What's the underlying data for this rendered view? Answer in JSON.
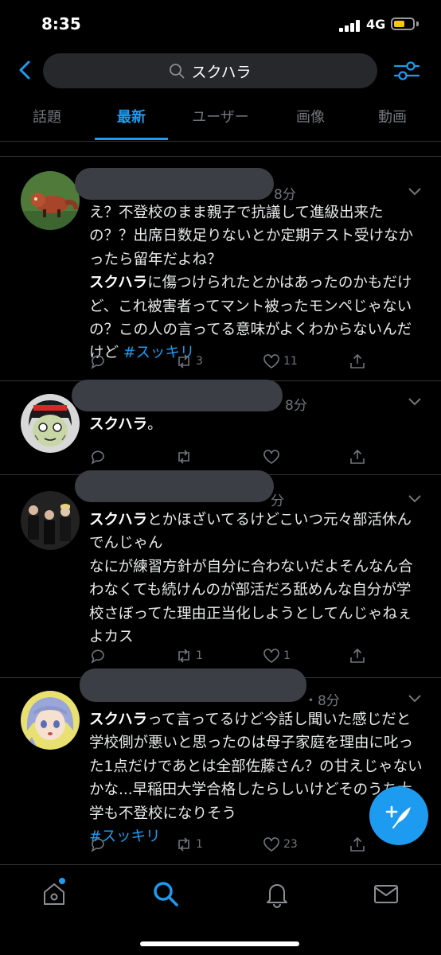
{
  "status_bar": {
    "time": "8:35",
    "network": "4G"
  },
  "search": {
    "query": "スクハラ"
  },
  "tabs": [
    {
      "label": "話題"
    },
    {
      "label": "最新"
    },
    {
      "label": "ユーザー"
    },
    {
      "label": "画像"
    },
    {
      "label": "動画"
    }
  ],
  "tweets": [
    {
      "time": "8分",
      "segments": [
        {
          "text": "え？不登校のまま親子で抗議して進級出来たの？？出席日数足りないとか定期テスト受けなかったら留年だよね？\n"
        },
        {
          "text": "スクハラ",
          "bold": true
        },
        {
          "text": "に傷つけられたとかはあったのかもだけど、これ被害者ってマント被ったモンペじゃないの？この人の言ってる意味がよくわからないんだけど "
        },
        {
          "text": "#スッキリ",
          "hashtag": true
        }
      ],
      "replies": "",
      "retweets": "3",
      "likes": "11"
    },
    {
      "time": "8分",
      "segments": [
        {
          "text": "スクハラ",
          "bold": true
        },
        {
          "text": "。"
        }
      ],
      "replies": "",
      "retweets": "",
      "likes": ""
    },
    {
      "time": "分",
      "segments": [
        {
          "text": "スクハラ",
          "bold": true
        },
        {
          "text": "とかほざいてるけどこいつ元々部活休んでんじゃん\nなにが練習方針が自分に合わないだよそんなん合わなくても続けんのが部活だろ舐めんな自分が学校さぼってた理由正当化しようとしてんじゃねぇよカス"
        }
      ],
      "replies": "",
      "retweets": "1",
      "likes": "1"
    },
    {
      "time": "・8分",
      "segments": [
        {
          "text": "スクハラ",
          "bold": true
        },
        {
          "text": "って言ってるけど今話し聞いた感じだと学校側が悪いと思ったのは母子家庭を理由に叱った1点だけであとは全部佐藤さん？の甘えじゃないかな...早稲田大学合格したらしいけどそのうち大学も不登校になりそう\n"
        },
        {
          "text": "#スッキリ",
          "hashtag": true
        }
      ],
      "replies": "",
      "retweets": "1",
      "likes": "23"
    }
  ],
  "icons": {
    "back": "chevron-left-icon",
    "search": "search-icon",
    "filter": "filter-sliders-icon",
    "reply": "reply-icon",
    "retweet": "retweet-icon",
    "like": "heart-icon",
    "share": "share-icon",
    "compose": "feather-compose-icon",
    "home": "home-icon",
    "explore": "search-icon",
    "notifications": "bell-icon",
    "messages": "mail-icon"
  },
  "colors": {
    "accent": "#1d9bf0",
    "background": "#000000",
    "muted": "#71767b",
    "battery": "#f5c518"
  },
  "battery_level": 0.6
}
